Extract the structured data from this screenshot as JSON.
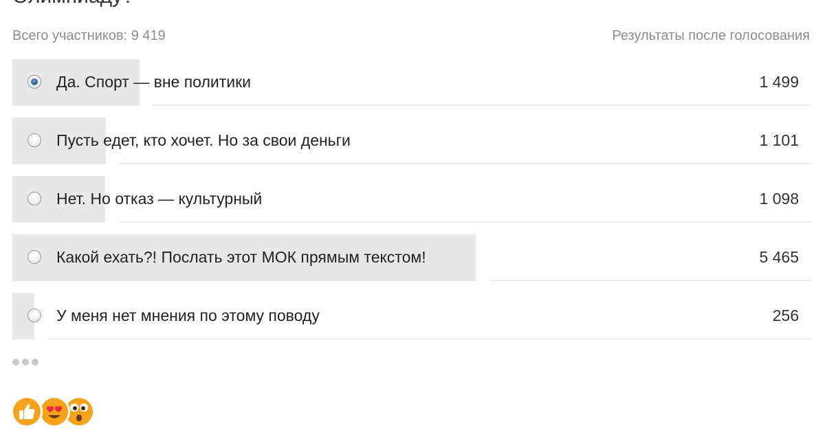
{
  "poll": {
    "question": "Олимпиаду?",
    "participants_text": "Всего участников: 9 419",
    "results_note": "Результаты после голосования",
    "total_votes": 9419,
    "options": [
      {
        "label": "Да. Спорт — вне политики",
        "count": "1 499",
        "votes": 1499,
        "selected": true
      },
      {
        "label": "Пусть едет, кто хочет. Но за свои деньги",
        "count": "1 101",
        "votes": 1101,
        "selected": false
      },
      {
        "label": "Нет. Но отказ — культурный",
        "count": "1 098",
        "votes": 1098,
        "selected": false
      },
      {
        "label": "Какой ехать?! Послать этот МОК прямым текстом!",
        "count": "5 465",
        "votes": 5465,
        "selected": false
      },
      {
        "label": "У меня нет мнения по этому поводу",
        "count": "256",
        "votes": 256,
        "selected": false
      }
    ]
  },
  "actions": {
    "more_icon": "more-dots-icon"
  },
  "reactions": [
    {
      "icon": "thumbs-up-icon",
      "color": "#f7a21b"
    },
    {
      "icon": "heart-eyes-icon",
      "color": "#f7a21b"
    },
    {
      "icon": "surprised-face-icon",
      "color": "#f7a21b"
    }
  ],
  "colors": {
    "bar": "#e8e8e8",
    "radio_selected": "#2f5a8f",
    "muted_text": "#8c8c8c"
  }
}
